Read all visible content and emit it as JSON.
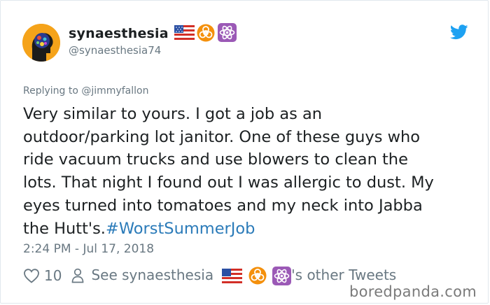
{
  "user": {
    "display_name": "synaesthesia",
    "handle": "@synaesthesia74",
    "badges": [
      "us-flag-icon",
      "biohazard-icon",
      "atom-icon"
    ]
  },
  "tweet": {
    "replying_to_prefix": "Replying to ",
    "replying_to_handle": "@jimmyfallon",
    "lines": [
      "Very similar to yours. I got a job as an",
      "outdoor/parking lot janitor. One of these guys who",
      "ride vacuum trucks and use blowers to clean the",
      "lots. That night I found out I was allergic to dust. My",
      "eyes turned into tomatoes and my neck into Jabba"
    ],
    "last_line_text": "the Hutt's.",
    "hashtag": "#WorstSummerJob",
    "timestamp": "2:24 PM - Jul 17, 2018"
  },
  "actions": {
    "like_count": "10",
    "see_other_prefix": "See synaesthesia",
    "see_other_suffix": "'s other Tweets"
  },
  "watermark": "boredpanda.com",
  "colors": {
    "link": "#2b7bb9",
    "twitter_blue": "#1da1f2",
    "muted": "#697882",
    "avatar_bg": "#f5a31a",
    "biohazard": "#f4900c",
    "atom_bg": "#9b59b6"
  }
}
